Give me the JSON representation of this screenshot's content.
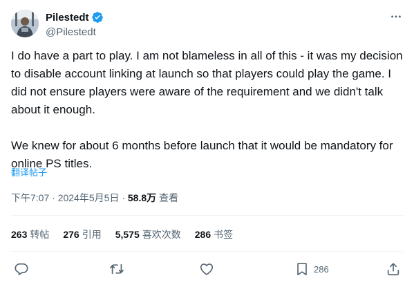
{
  "author": {
    "display_name": "Pilestedt",
    "handle": "@Pilestedt",
    "avatar_icon": "user-avatar",
    "verified_icon": "verified-badge-icon",
    "verified_color": "#1d9bf0"
  },
  "tweet": {
    "paragraphs": [
      "I do have a part to play. I am not blameless in all of this - it was my decision to disable account linking at launch so that players could play the game. I did not ensure players were aware of the requirement and we didn't talk about it enough.",
      "We knew for about 6 months before launch that it would be mandatory for online PS titles."
    ],
    "translate_label": "翻译帖子"
  },
  "meta": {
    "time": "下午7:07",
    "separator": "·",
    "date": "2024年5月5日",
    "views_count": "58.8万",
    "views_label": "查看"
  },
  "stats": [
    {
      "count": "263",
      "label": "转帖"
    },
    {
      "count": "276",
      "label": "引用"
    },
    {
      "count": "5,575",
      "label": "喜欢次数"
    },
    {
      "count": "286",
      "label": "书签"
    }
  ],
  "actions": {
    "reply_icon": "reply-icon",
    "retweet_icon": "retweet-icon",
    "like_icon": "like-icon",
    "bookmark_icon": "bookmark-icon",
    "bookmark_count": "286",
    "share_icon": "share-icon"
  },
  "colors": {
    "accent": "#1d9bf0",
    "text": "#0f1419",
    "secondary": "#536471",
    "divider": "#eff3f4"
  }
}
